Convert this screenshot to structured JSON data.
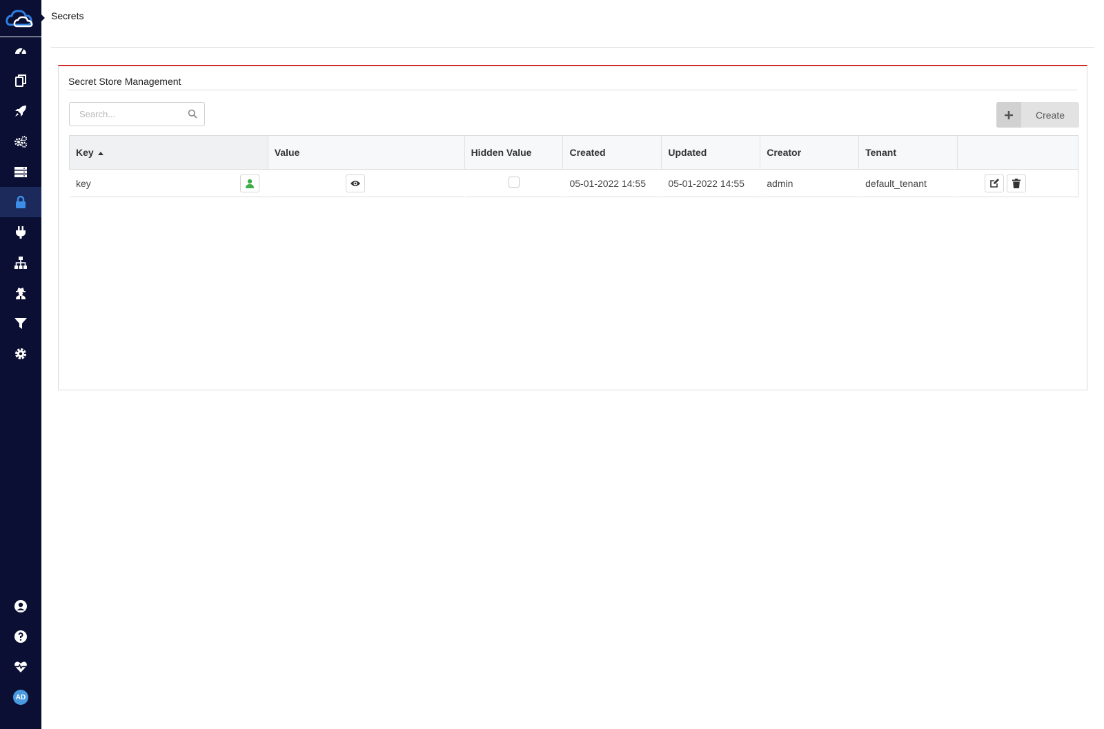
{
  "page": {
    "title": "Secrets"
  },
  "sidebar": {
    "logo": "cloud-logo-icon",
    "items": [
      {
        "icon": "dashboard-icon",
        "active": false
      },
      {
        "icon": "copy-icon",
        "active": false
      },
      {
        "icon": "rocket-icon",
        "active": false
      },
      {
        "icon": "cogs-icon",
        "active": false
      },
      {
        "icon": "server-icon",
        "active": false
      },
      {
        "icon": "lock-icon",
        "active": true
      },
      {
        "icon": "plug-icon",
        "active": false
      },
      {
        "icon": "sitemap-icon",
        "active": false
      },
      {
        "icon": "user-secret-icon",
        "active": false
      },
      {
        "icon": "filter-icon",
        "active": false
      },
      {
        "icon": "gear-icon",
        "active": false
      }
    ],
    "bottom_items": [
      {
        "icon": "user-circle-icon"
      },
      {
        "icon": "question-circle-icon"
      },
      {
        "icon": "heartbeat-icon"
      }
    ],
    "avatar_initials": "AD"
  },
  "panel": {
    "title": "Secret Store Management",
    "search_placeholder": "Search...",
    "create_label": "Create"
  },
  "table": {
    "columns": [
      "Key",
      "Value",
      "Hidden Value",
      "Created",
      "Updated",
      "Creator",
      "Tenant",
      ""
    ],
    "rows": [
      {
        "key": "key",
        "value": "",
        "hidden_value": false,
        "created": "05-01-2022 14:55",
        "updated": "05-01-2022 14:55",
        "creator": "admin",
        "tenant": "default_tenant"
      }
    ]
  },
  "colors": {
    "sidebar_bg": "#0b0f33",
    "panel_accent": "#d12b2b",
    "user_icon": "#3fae49",
    "avatar_bg": "#4a9ae1"
  }
}
